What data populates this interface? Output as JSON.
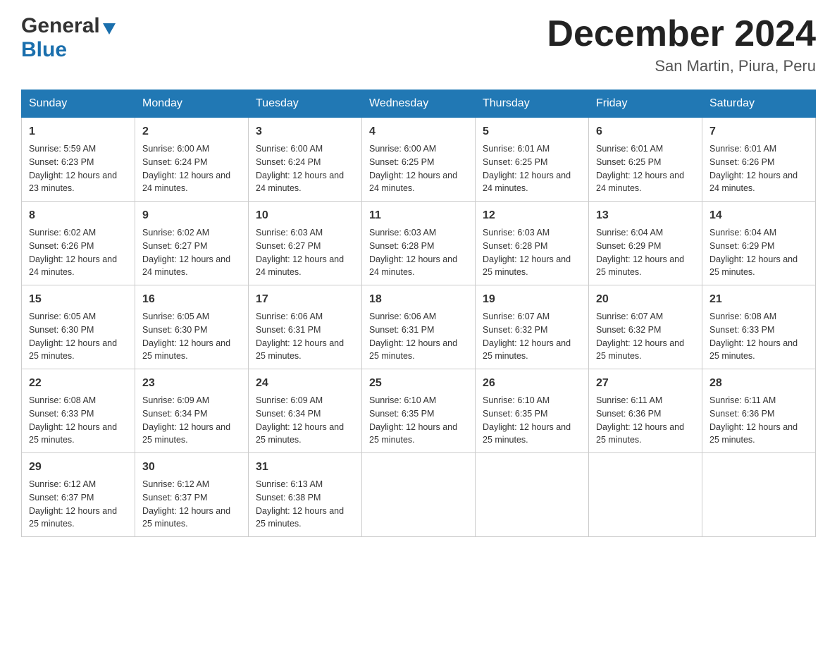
{
  "header": {
    "logo_general": "General",
    "logo_blue": "Blue",
    "month_title": "December 2024",
    "location": "San Martin, Piura, Peru"
  },
  "days_of_week": [
    "Sunday",
    "Monday",
    "Tuesday",
    "Wednesday",
    "Thursday",
    "Friday",
    "Saturday"
  ],
  "weeks": [
    [
      {
        "day": "1",
        "sunrise": "Sunrise: 5:59 AM",
        "sunset": "Sunset: 6:23 PM",
        "daylight": "Daylight: 12 hours and 23 minutes."
      },
      {
        "day": "2",
        "sunrise": "Sunrise: 6:00 AM",
        "sunset": "Sunset: 6:24 PM",
        "daylight": "Daylight: 12 hours and 24 minutes."
      },
      {
        "day": "3",
        "sunrise": "Sunrise: 6:00 AM",
        "sunset": "Sunset: 6:24 PM",
        "daylight": "Daylight: 12 hours and 24 minutes."
      },
      {
        "day": "4",
        "sunrise": "Sunrise: 6:00 AM",
        "sunset": "Sunset: 6:25 PM",
        "daylight": "Daylight: 12 hours and 24 minutes."
      },
      {
        "day": "5",
        "sunrise": "Sunrise: 6:01 AM",
        "sunset": "Sunset: 6:25 PM",
        "daylight": "Daylight: 12 hours and 24 minutes."
      },
      {
        "day": "6",
        "sunrise": "Sunrise: 6:01 AM",
        "sunset": "Sunset: 6:25 PM",
        "daylight": "Daylight: 12 hours and 24 minutes."
      },
      {
        "day": "7",
        "sunrise": "Sunrise: 6:01 AM",
        "sunset": "Sunset: 6:26 PM",
        "daylight": "Daylight: 12 hours and 24 minutes."
      }
    ],
    [
      {
        "day": "8",
        "sunrise": "Sunrise: 6:02 AM",
        "sunset": "Sunset: 6:26 PM",
        "daylight": "Daylight: 12 hours and 24 minutes."
      },
      {
        "day": "9",
        "sunrise": "Sunrise: 6:02 AM",
        "sunset": "Sunset: 6:27 PM",
        "daylight": "Daylight: 12 hours and 24 minutes."
      },
      {
        "day": "10",
        "sunrise": "Sunrise: 6:03 AM",
        "sunset": "Sunset: 6:27 PM",
        "daylight": "Daylight: 12 hours and 24 minutes."
      },
      {
        "day": "11",
        "sunrise": "Sunrise: 6:03 AM",
        "sunset": "Sunset: 6:28 PM",
        "daylight": "Daylight: 12 hours and 24 minutes."
      },
      {
        "day": "12",
        "sunrise": "Sunrise: 6:03 AM",
        "sunset": "Sunset: 6:28 PM",
        "daylight": "Daylight: 12 hours and 25 minutes."
      },
      {
        "day": "13",
        "sunrise": "Sunrise: 6:04 AM",
        "sunset": "Sunset: 6:29 PM",
        "daylight": "Daylight: 12 hours and 25 minutes."
      },
      {
        "day": "14",
        "sunrise": "Sunrise: 6:04 AM",
        "sunset": "Sunset: 6:29 PM",
        "daylight": "Daylight: 12 hours and 25 minutes."
      }
    ],
    [
      {
        "day": "15",
        "sunrise": "Sunrise: 6:05 AM",
        "sunset": "Sunset: 6:30 PM",
        "daylight": "Daylight: 12 hours and 25 minutes."
      },
      {
        "day": "16",
        "sunrise": "Sunrise: 6:05 AM",
        "sunset": "Sunset: 6:30 PM",
        "daylight": "Daylight: 12 hours and 25 minutes."
      },
      {
        "day": "17",
        "sunrise": "Sunrise: 6:06 AM",
        "sunset": "Sunset: 6:31 PM",
        "daylight": "Daylight: 12 hours and 25 minutes."
      },
      {
        "day": "18",
        "sunrise": "Sunrise: 6:06 AM",
        "sunset": "Sunset: 6:31 PM",
        "daylight": "Daylight: 12 hours and 25 minutes."
      },
      {
        "day": "19",
        "sunrise": "Sunrise: 6:07 AM",
        "sunset": "Sunset: 6:32 PM",
        "daylight": "Daylight: 12 hours and 25 minutes."
      },
      {
        "day": "20",
        "sunrise": "Sunrise: 6:07 AM",
        "sunset": "Sunset: 6:32 PM",
        "daylight": "Daylight: 12 hours and 25 minutes."
      },
      {
        "day": "21",
        "sunrise": "Sunrise: 6:08 AM",
        "sunset": "Sunset: 6:33 PM",
        "daylight": "Daylight: 12 hours and 25 minutes."
      }
    ],
    [
      {
        "day": "22",
        "sunrise": "Sunrise: 6:08 AM",
        "sunset": "Sunset: 6:33 PM",
        "daylight": "Daylight: 12 hours and 25 minutes."
      },
      {
        "day": "23",
        "sunrise": "Sunrise: 6:09 AM",
        "sunset": "Sunset: 6:34 PM",
        "daylight": "Daylight: 12 hours and 25 minutes."
      },
      {
        "day": "24",
        "sunrise": "Sunrise: 6:09 AM",
        "sunset": "Sunset: 6:34 PM",
        "daylight": "Daylight: 12 hours and 25 minutes."
      },
      {
        "day": "25",
        "sunrise": "Sunrise: 6:10 AM",
        "sunset": "Sunset: 6:35 PM",
        "daylight": "Daylight: 12 hours and 25 minutes."
      },
      {
        "day": "26",
        "sunrise": "Sunrise: 6:10 AM",
        "sunset": "Sunset: 6:35 PM",
        "daylight": "Daylight: 12 hours and 25 minutes."
      },
      {
        "day": "27",
        "sunrise": "Sunrise: 6:11 AM",
        "sunset": "Sunset: 6:36 PM",
        "daylight": "Daylight: 12 hours and 25 minutes."
      },
      {
        "day": "28",
        "sunrise": "Sunrise: 6:11 AM",
        "sunset": "Sunset: 6:36 PM",
        "daylight": "Daylight: 12 hours and 25 minutes."
      }
    ],
    [
      {
        "day": "29",
        "sunrise": "Sunrise: 6:12 AM",
        "sunset": "Sunset: 6:37 PM",
        "daylight": "Daylight: 12 hours and 25 minutes."
      },
      {
        "day": "30",
        "sunrise": "Sunrise: 6:12 AM",
        "sunset": "Sunset: 6:37 PM",
        "daylight": "Daylight: 12 hours and 25 minutes."
      },
      {
        "day": "31",
        "sunrise": "Sunrise: 6:13 AM",
        "sunset": "Sunset: 6:38 PM",
        "daylight": "Daylight: 12 hours and 25 minutes."
      },
      {
        "day": "",
        "sunrise": "",
        "sunset": "",
        "daylight": ""
      },
      {
        "day": "",
        "sunrise": "",
        "sunset": "",
        "daylight": ""
      },
      {
        "day": "",
        "sunrise": "",
        "sunset": "",
        "daylight": ""
      },
      {
        "day": "",
        "sunrise": "",
        "sunset": "",
        "daylight": ""
      }
    ]
  ]
}
